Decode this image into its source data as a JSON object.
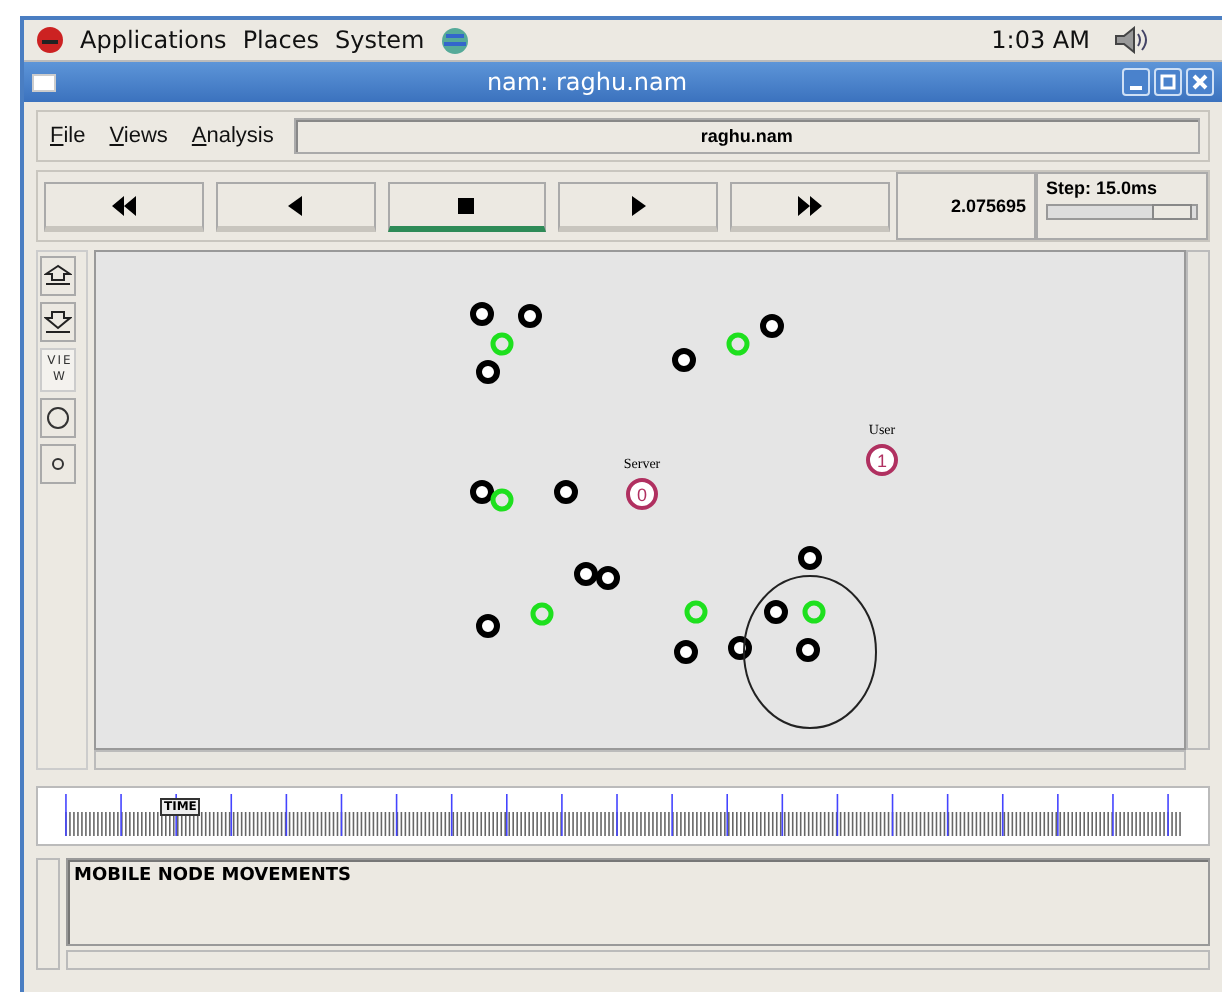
{
  "top_panel": {
    "menus": [
      "Applications",
      "Places",
      "System"
    ],
    "clock": "1:03 AM"
  },
  "window": {
    "title": "nam: raghu.nam"
  },
  "menu_bar": {
    "items": [
      "File",
      "Views",
      "Analysis"
    ],
    "file_name": "raghu.nam"
  },
  "playback": {
    "buttons": [
      {
        "kind": "rewind",
        "selected": false
      },
      {
        "kind": "back",
        "selected": false
      },
      {
        "kind": "stop",
        "selected": true
      },
      {
        "kind": "play",
        "selected": false
      },
      {
        "kind": "forward",
        "selected": false
      }
    ],
    "time": "2.075695",
    "step": {
      "label": "Step: 15.0ms",
      "level": 0.82
    }
  },
  "tools": {
    "view_label": "VIEW"
  },
  "canvas": {
    "nodes": [
      {
        "label": "Server",
        "number": "0"
      },
      {
        "label": "User",
        "number": "1"
      }
    ]
  },
  "timeline": {
    "marker": "TIME"
  },
  "log": {
    "text": "MOBILE NODE MOVEMENTS"
  }
}
